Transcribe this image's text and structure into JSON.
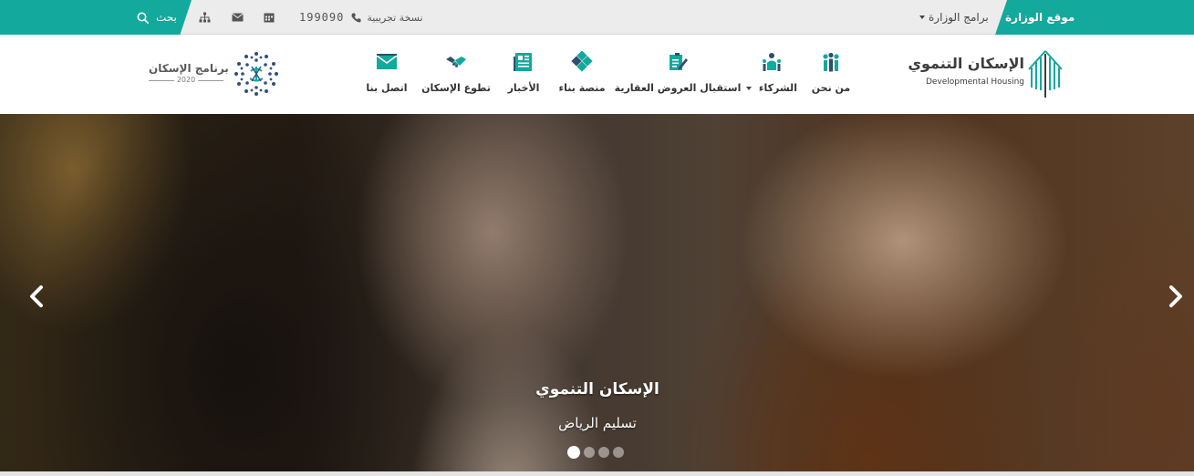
{
  "topbar": {
    "ministry_site": "موقع الوزارة",
    "ministry_programs": "برامج الوزارة",
    "beta_label": "نسخة تجريبية",
    "phone": "199090",
    "search_label": "بحث"
  },
  "nav": {
    "items": [
      {
        "label": "من نحن",
        "icon": "people-icon"
      },
      {
        "label": "الشركاء",
        "icon": "partner-icon",
        "dropdown": true
      },
      {
        "label": "استقبال العروض العقارية",
        "icon": "document-edit-icon"
      },
      {
        "label": "منصة بناء",
        "icon": "diamond-grid-icon"
      },
      {
        "label": "الأخبار",
        "icon": "newspaper-icon"
      },
      {
        "label": "تطوع الإسكان",
        "icon": "handshake-icon"
      },
      {
        "label": "اتصل بنا",
        "icon": "envelope-icon"
      }
    ]
  },
  "logo": {
    "arabic": "الإسكان التنموي",
    "english": "Developmental Housing"
  },
  "vision": {
    "name": "برنامج الإسكان",
    "year": "2020"
  },
  "hero": {
    "title": "الإسكان التنموي",
    "subtitle": "تسليم الرياض",
    "slide_count": 4,
    "active_slide": 1
  },
  "colors": {
    "teal": "#13a99d",
    "nav_text": "#333333"
  }
}
